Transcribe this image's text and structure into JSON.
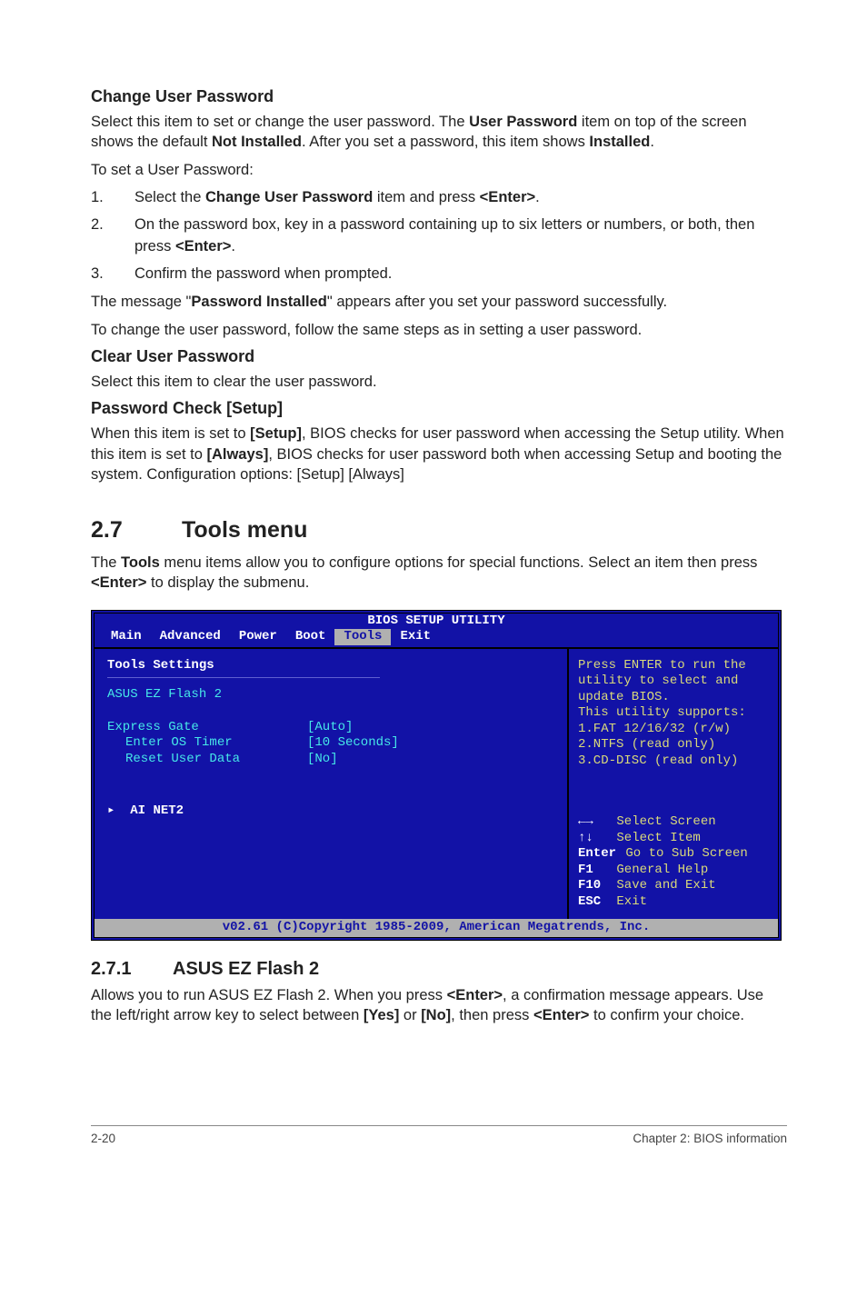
{
  "sec_cup": {
    "title": "Change User Password",
    "p1_a": "Select this item to set or change the user password. The ",
    "p1_b": "User Password",
    "p1_c": " item on top of the screen shows the default ",
    "p1_d": "Not Installed",
    "p1_e": ". After you set a password, this item shows ",
    "p1_f": "Installed",
    "p1_g": ".",
    "p2": "To set a User Password:",
    "steps": [
      {
        "n": "1.",
        "a": "Select the ",
        "b": "Change User Password",
        "c": " item and press ",
        "d": "<Enter>",
        "e": "."
      },
      {
        "n": "2.",
        "a": "On the password box, key in a password containing up to six letters or numbers, or both, then press ",
        "b": "<Enter>",
        "c": "."
      },
      {
        "n": "3.",
        "a": "Confirm the password when prompted."
      }
    ],
    "p3_a": "The message \"",
    "p3_b": "Password Installed",
    "p3_c": "\" appears after you set your password successfully.",
    "p4": "To change the user password, follow the same steps as in setting a user password."
  },
  "sec_clear": {
    "title": "Clear User Password",
    "p1": "Select this item to clear the user password."
  },
  "sec_pw": {
    "title": "Password Check [Setup]",
    "p1_a": "When this item is set to ",
    "p1_b": "[Setup]",
    "p1_c": ", BIOS checks for user password when accessing the Setup utility. When this item is set to ",
    "p1_d": "[Always]",
    "p1_e": ", BIOS checks for user password both when accessing Setup and booting the system. Configuration options: [Setup] [Always]"
  },
  "h27": {
    "num": "2.7",
    "title": "Tools menu"
  },
  "p27_a": "The ",
  "p27_b": "Tools",
  "p27_c": " menu items allow you to configure options for special functions. Select an item then press ",
  "p27_d": "<Enter>",
  "p27_e": " to display the submenu.",
  "bios": {
    "title": "BIOS SETUP UTILITY",
    "tabs": [
      "Main",
      "Advanced",
      "Power",
      "Boot",
      "Tools",
      "Exit"
    ],
    "left": {
      "heading": "Tools Settings",
      "item1": "ASUS EZ Flash 2",
      "rows": [
        {
          "label": "Express Gate",
          "value": "[Auto]"
        },
        {
          "label": "Enter OS Timer",
          "value": "[10 Seconds]"
        },
        {
          "label": "Reset User Data",
          "value": "[No]"
        }
      ],
      "item2": "AI NET2"
    },
    "right": {
      "help": [
        "Press ENTER to run the",
        "utility to select and",
        "update BIOS.",
        "This utility supports:",
        "1.FAT 12/16/32 (r/w)",
        "2.NTFS (read only)",
        "3.CD-DISC (read only)"
      ],
      "nav": [
        {
          "key": "←→",
          "label": "Select Screen"
        },
        {
          "key": "↑↓",
          "label": "Select Item"
        },
        {
          "key": "Enter",
          "label": "Go to Sub Screen"
        },
        {
          "key": "F1",
          "label": "General Help"
        },
        {
          "key": "F10",
          "label": "Save and Exit"
        },
        {
          "key": "ESC",
          "label": "Exit"
        }
      ]
    },
    "footer": "v02.61 (C)Copyright 1985-2009, American Megatrends, Inc."
  },
  "h271": {
    "num": "2.7.1",
    "title": "ASUS EZ Flash 2"
  },
  "p271_a": "Allows you to run ASUS EZ Flash 2. When you press ",
  "p271_b": "<Enter>",
  "p271_c": ", a confirmation message appears. Use the left/right arrow key to select between ",
  "p271_d": "[Yes]",
  "p271_e": " or ",
  "p271_f": "[No]",
  "p271_g": ", then press ",
  "p271_h": "<Enter>",
  "p271_i": " to confirm your choice.",
  "footer": {
    "left": "2-20",
    "right": "Chapter 2: BIOS information"
  }
}
